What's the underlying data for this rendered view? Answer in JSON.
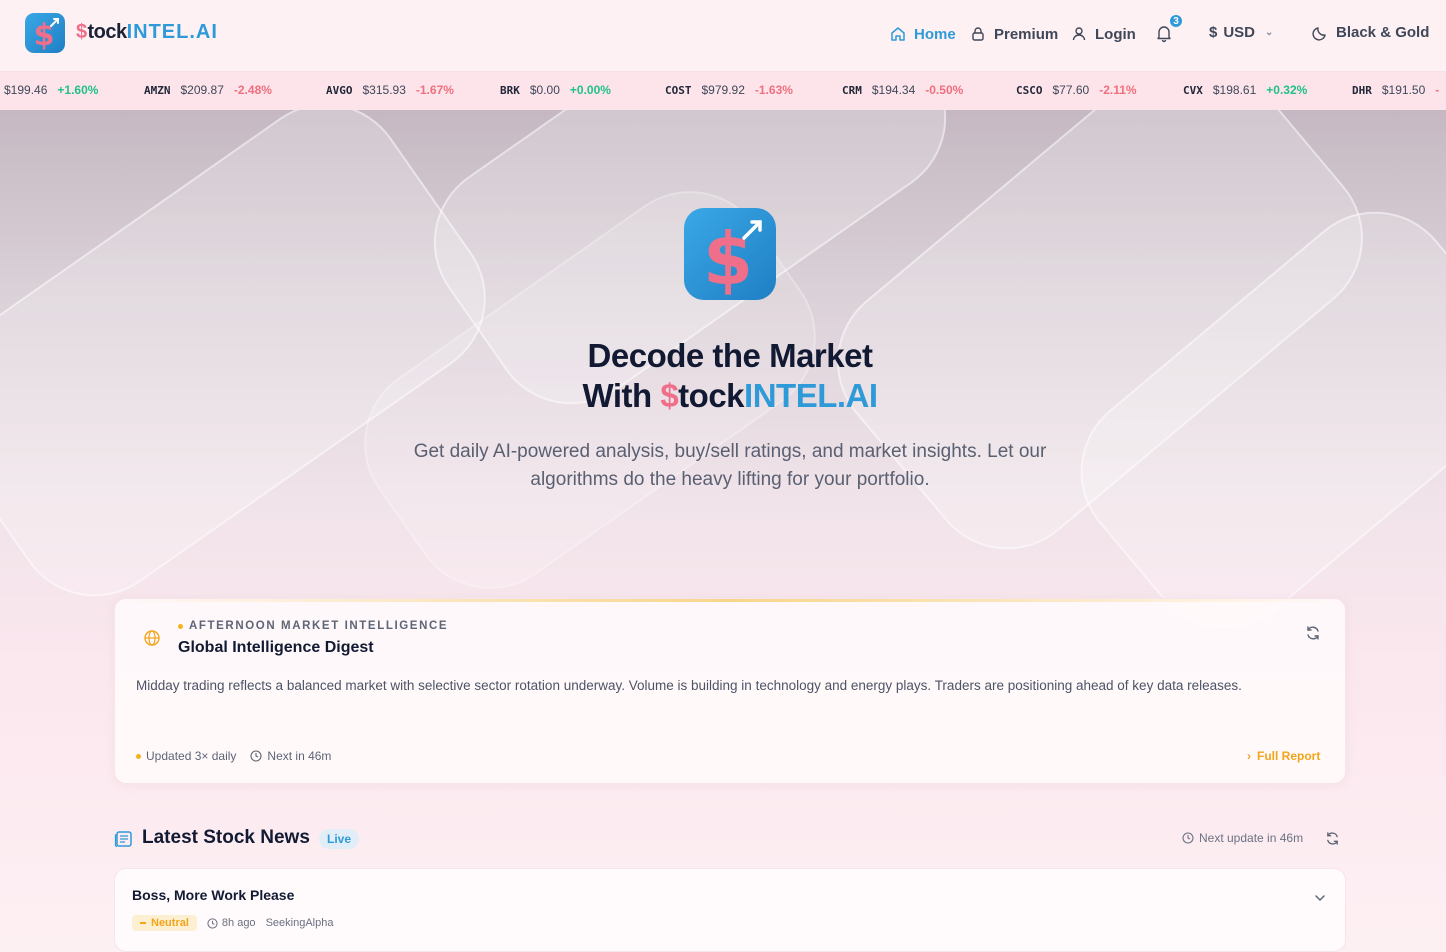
{
  "header": {
    "brand": {
      "s": "$",
      "tock": "tock",
      "intel": "INTEL.AI"
    },
    "nav": {
      "home": "Home",
      "premium": "Premium",
      "login": "Login"
    },
    "notifications_count": "3",
    "currency": {
      "symbol": "$",
      "code": "USD"
    },
    "theme_label": "Black & Gold"
  },
  "ticker": [
    {
      "sym": "",
      "price": "$199.46",
      "chg": "+1.60%",
      "dir": "up"
    },
    {
      "sym": "AMZN",
      "price": "$209.87",
      "chg": "-2.48%",
      "dir": "down"
    },
    {
      "sym": "AVGO",
      "price": "$315.93",
      "chg": "-1.67%",
      "dir": "down"
    },
    {
      "sym": "BRK",
      "price": "$0.00",
      "chg": "+0.00%",
      "dir": "flat"
    },
    {
      "sym": "COST",
      "price": "$979.92",
      "chg": "-1.63%",
      "dir": "down"
    },
    {
      "sym": "CRM",
      "price": "$194.34",
      "chg": "-0.50%",
      "dir": "down"
    },
    {
      "sym": "CSCO",
      "price": "$77.60",
      "chg": "-2.11%",
      "dir": "down"
    },
    {
      "sym": "CVX",
      "price": "$198.61",
      "chg": "+0.32%",
      "dir": "up"
    },
    {
      "sym": "DHR",
      "price": "$191.50",
      "chg": "-",
      "dir": "down"
    }
  ],
  "hero": {
    "line1": "Decode the Market",
    "line2_prefix": "With ",
    "brand_s": "$",
    "brand_tock": "tock",
    "brand_intel": "INTEL.AI",
    "subtitle": "Get daily AI-powered analysis, buy/sell ratings, and market insights. Let our algorithms do the heavy lifting for your portfolio."
  },
  "digest": {
    "eyebrow": "AFTERNOON MARKET INTELLIGENCE",
    "title": "Global Intelligence Digest",
    "body": "Midday trading reflects a balanced market with selective sector rotation underway. Volume is building in technology and energy plays. Traders are positioning ahead of key data releases.",
    "updated": "Updated 3× daily",
    "next": "Next in 46m",
    "full_report": "Full Report"
  },
  "news": {
    "title": "Latest Stock News",
    "live": "Live",
    "next_update": "Next update in 46m",
    "items": [
      {
        "headline": "Boss, More Work Please",
        "sentiment": "Neutral",
        "age": "8h ago",
        "source": "SeekingAlpha"
      }
    ]
  },
  "colors": {
    "accent_blue": "#2f9ad8",
    "brand_pink": "#ef6f8a",
    "gold": "#f2a51b",
    "up_green": "#22c08a",
    "down_red": "#f06f7e"
  }
}
